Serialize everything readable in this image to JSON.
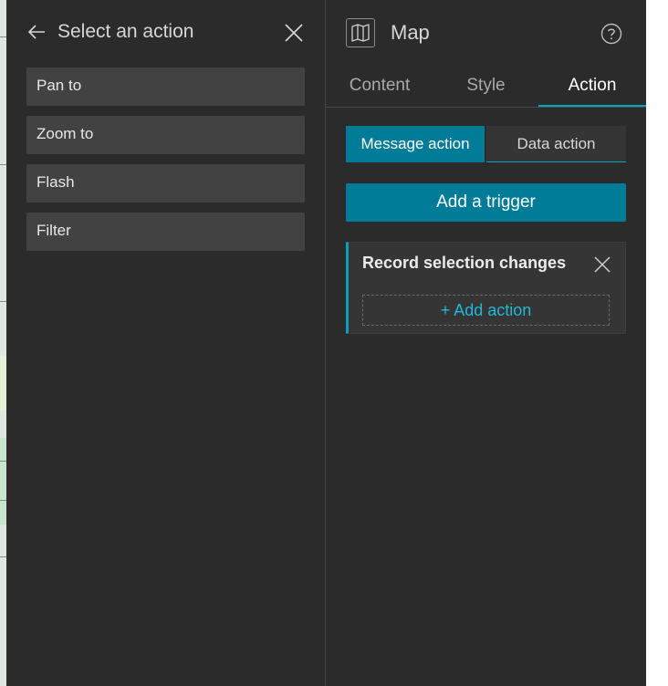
{
  "left_panel": {
    "back_icon": "arrow-left-icon",
    "title": "Select an action",
    "close_icon": "close-icon",
    "actions": [
      {
        "label": "Pan to"
      },
      {
        "label": "Zoom to"
      },
      {
        "label": "Flash"
      },
      {
        "label": "Filter"
      }
    ]
  },
  "right_panel": {
    "widget_icon": "map-icon",
    "title": "Map",
    "help_icon": "help-icon",
    "tabs": [
      {
        "label": "Content"
      },
      {
        "label": "Style"
      },
      {
        "label": "Action",
        "active": true
      }
    ],
    "segmented": {
      "message_action": "Message action",
      "data_action": "Data action",
      "selected": "Message action"
    },
    "add_trigger_label": "Add a trigger",
    "trigger": {
      "title": "Record selection changes",
      "add_action_plus": "+",
      "add_action_label": "Add action"
    }
  },
  "colors": {
    "accent": "#007c99",
    "accent_light": "#0aa0c0",
    "panel_bg": "#2b2b2b",
    "item_bg": "#424242"
  }
}
